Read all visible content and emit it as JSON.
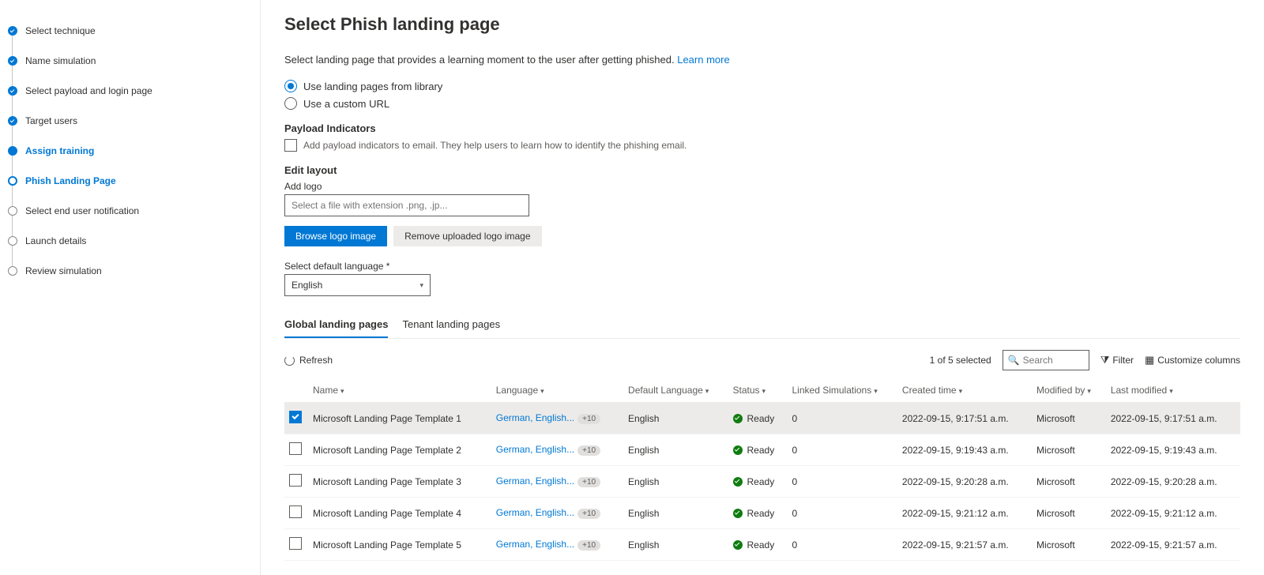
{
  "steps": [
    {
      "label": "Select technique",
      "state": "done"
    },
    {
      "label": "Name simulation",
      "state": "done"
    },
    {
      "label": "Select payload and login page",
      "state": "done"
    },
    {
      "label": "Target users",
      "state": "done"
    },
    {
      "label": "Assign training",
      "state": "current"
    },
    {
      "label": "Phish Landing Page",
      "state": "active"
    },
    {
      "label": "Select end user notification",
      "state": "pending"
    },
    {
      "label": "Launch details",
      "state": "pending"
    },
    {
      "label": "Review simulation",
      "state": "pending"
    }
  ],
  "header": {
    "title": "Select Phish landing page",
    "description": "Select landing page that provides a learning moment to the user after getting phished.",
    "learn_more": "Learn more"
  },
  "radios": {
    "library": "Use landing pages from library",
    "custom": "Use a custom URL"
  },
  "payload": {
    "title": "Payload Indicators",
    "checkbox_label": "Add payload indicators to email. They help users to learn how to identify the phishing email."
  },
  "layout": {
    "title": "Edit layout",
    "add_logo": "Add logo",
    "file_placeholder": "Select a file with extension .png, .jp...",
    "browse_btn": "Browse logo image",
    "remove_btn": "Remove uploaded logo image"
  },
  "language": {
    "label": "Select default language *",
    "value": "English"
  },
  "tabs": {
    "global": "Global landing pages",
    "tenant": "Tenant landing pages"
  },
  "toolbar": {
    "refresh": "Refresh",
    "selection": "1 of 5 selected",
    "search_placeholder": "Search",
    "filter": "Filter",
    "customize": "Customize columns"
  },
  "table": {
    "headers": {
      "name": "Name",
      "language": "Language",
      "default_lang": "Default Language",
      "status": "Status",
      "linked": "Linked Simulations",
      "created": "Created time",
      "modified_by": "Modified by",
      "last_modified": "Last modified"
    },
    "rows": [
      {
        "checked": true,
        "name": "Microsoft Landing Page Template 1",
        "lang": "German, English...",
        "lang_extra": "+10",
        "default": "English",
        "status": "Ready",
        "linked": "0",
        "created": "2022-09-15, 9:17:51 a.m.",
        "by": "Microsoft",
        "modified": "2022-09-15, 9:17:51 a.m."
      },
      {
        "checked": false,
        "name": "Microsoft Landing Page Template 2",
        "lang": "German, English...",
        "lang_extra": "+10",
        "default": "English",
        "status": "Ready",
        "linked": "0",
        "created": "2022-09-15, 9:19:43 a.m.",
        "by": "Microsoft",
        "modified": "2022-09-15, 9:19:43 a.m."
      },
      {
        "checked": false,
        "name": "Microsoft Landing Page Template 3",
        "lang": "German, English...",
        "lang_extra": "+10",
        "default": "English",
        "status": "Ready",
        "linked": "0",
        "created": "2022-09-15, 9:20:28 a.m.",
        "by": "Microsoft",
        "modified": "2022-09-15, 9:20:28 a.m."
      },
      {
        "checked": false,
        "name": "Microsoft Landing Page Template 4",
        "lang": "German, English...",
        "lang_extra": "+10",
        "default": "English",
        "status": "Ready",
        "linked": "0",
        "created": "2022-09-15, 9:21:12 a.m.",
        "by": "Microsoft",
        "modified": "2022-09-15, 9:21:12 a.m."
      },
      {
        "checked": false,
        "name": "Microsoft Landing Page Template 5",
        "lang": "German, English...",
        "lang_extra": "+10",
        "default": "English",
        "status": "Ready",
        "linked": "0",
        "created": "2022-09-15, 9:21:57 a.m.",
        "by": "Microsoft",
        "modified": "2022-09-15, 9:21:57 a.m."
      }
    ]
  }
}
